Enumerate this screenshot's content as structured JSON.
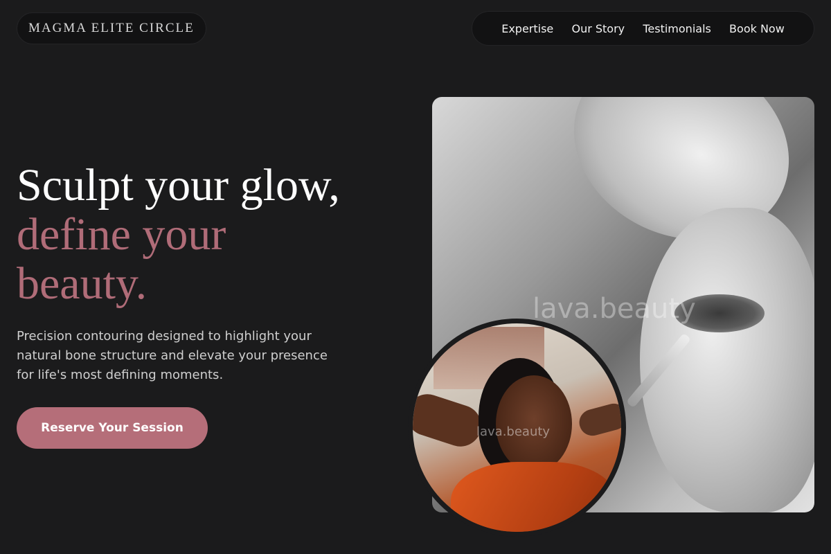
{
  "header": {
    "brand": "MAGMA ELITE CIRCLE",
    "nav": [
      {
        "label": "Expertise"
      },
      {
        "label": "Our Story"
      },
      {
        "label": "Testimonials"
      },
      {
        "label": "Book Now"
      }
    ]
  },
  "hero": {
    "headline_line1": "Sculpt your glow,",
    "headline_line2": "define your",
    "headline_line3": "beauty.",
    "description": "Precision contouring designed to highlight your natural bone structure and elevate your presence for life's most defining moments.",
    "cta_label": "Reserve Your Session"
  },
  "images": {
    "main_watermark": "lava.beauty",
    "circle_watermark": "lava.beauty"
  },
  "colors": {
    "background": "#1b1b1c",
    "accent": "#b56e79",
    "headline_rose": "#b06c78"
  }
}
